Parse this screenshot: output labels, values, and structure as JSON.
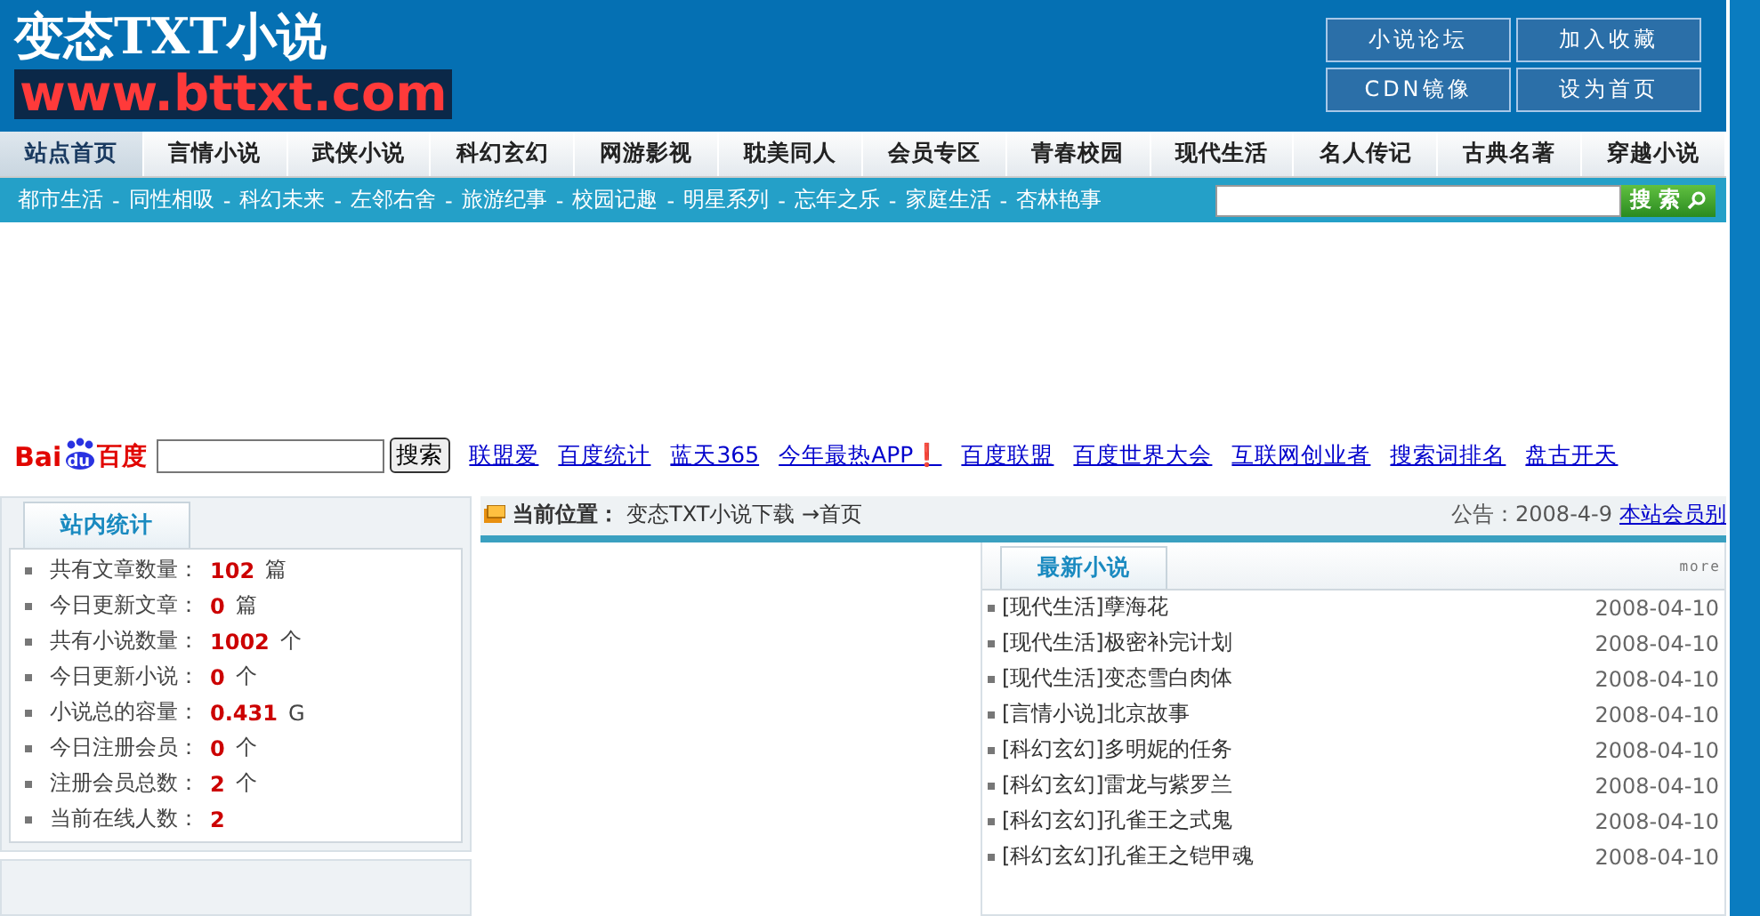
{
  "header": {
    "logo_title": "变态TXT小说",
    "logo_url": "www.bttxt.com",
    "buttons": [
      "小说论坛",
      "加入收藏",
      "CDN镜像",
      "设为首页"
    ]
  },
  "nav": [
    {
      "label": "站点首页",
      "selected": true
    },
    {
      "label": "言情小说",
      "selected": false
    },
    {
      "label": "武侠小说",
      "selected": false
    },
    {
      "label": "科幻玄幻",
      "selected": false
    },
    {
      "label": "网游影视",
      "selected": false
    },
    {
      "label": "耽美同人",
      "selected": false
    },
    {
      "label": "会员专区",
      "selected": false
    },
    {
      "label": "青春校园",
      "selected": false
    },
    {
      "label": "现代生活",
      "selected": false
    },
    {
      "label": "名人传记",
      "selected": false
    },
    {
      "label": "古典名著",
      "selected": false
    },
    {
      "label": "穿越小说",
      "selected": false
    }
  ],
  "subnav": {
    "links": [
      "都市生活",
      "同性相吸",
      "科幻未来",
      "左邻右舍",
      "旅游纪事",
      "校园记趣",
      "明星系列",
      "忘年之乐",
      "家庭生活",
      "杏林艳事"
    ],
    "separator": "-",
    "search_button": "搜 索"
  },
  "baidu": {
    "logo_left": "Bai",
    "logo_mid": "du",
    "logo_right": "百度",
    "search_button": "搜索",
    "links": [
      "联盟爱",
      "百度统计",
      "蓝天365",
      "今年最热APP❗",
      "百度联盟",
      "百度世界大会",
      "互联网创业者",
      "搜索词排名",
      "盘古开天"
    ]
  },
  "stats": {
    "title": "站内统计",
    "rows": [
      {
        "label": "共有文章数量：",
        "value": "102",
        "unit": "篇"
      },
      {
        "label": "今日更新文章：",
        "value": "0",
        "unit": "篇"
      },
      {
        "label": "共有小说数量：",
        "value": "1002",
        "unit": "个"
      },
      {
        "label": "今日更新小说：",
        "value": "0",
        "unit": "个"
      },
      {
        "label": "小说总的容量：",
        "value": "0.431",
        "unit": "G"
      },
      {
        "label": "今日注册会员：",
        "value": "0",
        "unit": "个"
      },
      {
        "label": "注册会员总数：",
        "value": "2",
        "unit": "个"
      },
      {
        "label": "当前在线人数：",
        "value": "2"
      }
    ]
  },
  "breadcrumb": {
    "label": "当前位置：",
    "path": "变态TXT小说下载 →首页"
  },
  "notice": {
    "label": "公告：2008-4-9",
    "link": "本站会员别"
  },
  "latest": {
    "title": "最新小说",
    "more": "more",
    "rows": [
      {
        "title": "[现代生活]孽海花",
        "date": "2008-04-10"
      },
      {
        "title": "[现代生活]极密补完计划",
        "date": "2008-04-10"
      },
      {
        "title": "[现代生活]变态雪白肉体",
        "date": "2008-04-10"
      },
      {
        "title": "[言情小说]北京故事",
        "date": "2008-04-10"
      },
      {
        "title": "[科幻玄幻]多明妮的任务",
        "date": "2008-04-10"
      },
      {
        "title": "[科幻玄幻]雷龙与紫罗兰",
        "date": "2008-04-10"
      },
      {
        "title": "[科幻玄幻]孔雀王之式鬼",
        "date": "2008-04-10"
      },
      {
        "title": "[科幻玄幻]孔雀王之铠甲魂",
        "date": "2008-04-10"
      }
    ]
  }
}
